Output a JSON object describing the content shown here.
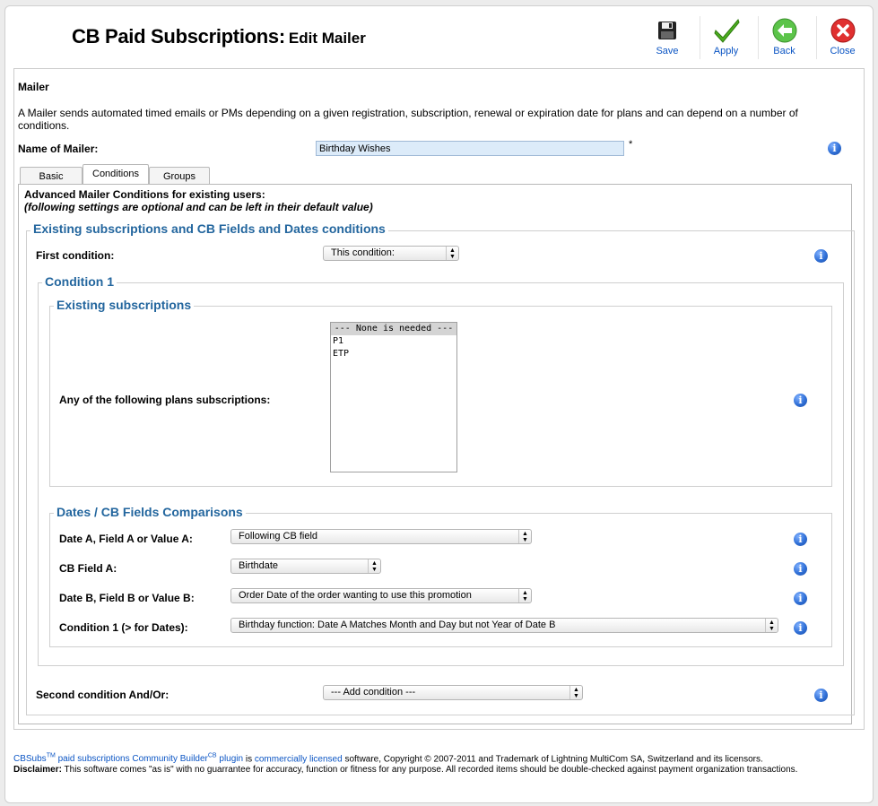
{
  "header": {
    "title": "CB Paid Subscriptions:",
    "subtitle": "Edit Mailer"
  },
  "toolbar": {
    "save": "Save",
    "apply": "Apply",
    "back": "Back",
    "close": "Close"
  },
  "mailer": {
    "heading": "Mailer",
    "description": "A Mailer sends automated timed emails or PMs depending on a given registration, subscription, renewal or expiration date for plans and can depend on a number of conditions.",
    "name_label": "Name of Mailer:",
    "name_value": "Birthday Wishes",
    "required_mark": "*"
  },
  "tabs": [
    {
      "label": "Basic"
    },
    {
      "label": "Conditions"
    },
    {
      "label": "Groups"
    }
  ],
  "conditions": {
    "intro": "Advanced Mailer Conditions for existing users:",
    "note": "(following settings are optional and can be left in their default value)",
    "section_title": "Existing subscriptions and CB Fields and Dates conditions",
    "first_condition_label": "First condition:",
    "first_condition_value": "This condition:",
    "condition1_title": "Condition 1",
    "existing_subs_title": "Existing subscriptions",
    "plans_label": "Any of the following plans subscriptions:",
    "plans_options": [
      "--- None is needed ---",
      "P1",
      "ETP"
    ],
    "comparisons_title": "Dates / CB Fields Comparisons",
    "date_a_label": "Date A, Field A or Value A:",
    "date_a_value": "Following CB field",
    "cb_field_a_label": "CB Field A:",
    "cb_field_a_value": "Birthdate",
    "date_b_label": "Date B, Field B or Value B:",
    "date_b_value": "Order Date of the order wanting to use this promotion",
    "cond1_label": "Condition 1 (> for Dates):",
    "cond1_value": "Birthday function: Date A Matches Month and Day but not Year of Date B",
    "second_condition_label": "Second condition And/Or:",
    "second_condition_value": "--- Add condition ---"
  },
  "footer": {
    "cbsubs": "CBSubs",
    "tm": "TM",
    "paid_link": " paid subscriptions Community Builder",
    "cb_sup": "CB",
    "plugin": " plugin",
    "is": " is ",
    "licensed": "commercially licensed",
    "rest": " software, Copyright © 2007-2011 and Trademark of Lightning MultiCom SA, Switzerland and its licensors.",
    "disclaimer_label": "Disclaimer:",
    "disclaimer_text": " This software comes \"as is\" with no guarrantee for accuracy, function or fitness for any purpose. All recorded items should be double-checked against payment organization transactions."
  }
}
